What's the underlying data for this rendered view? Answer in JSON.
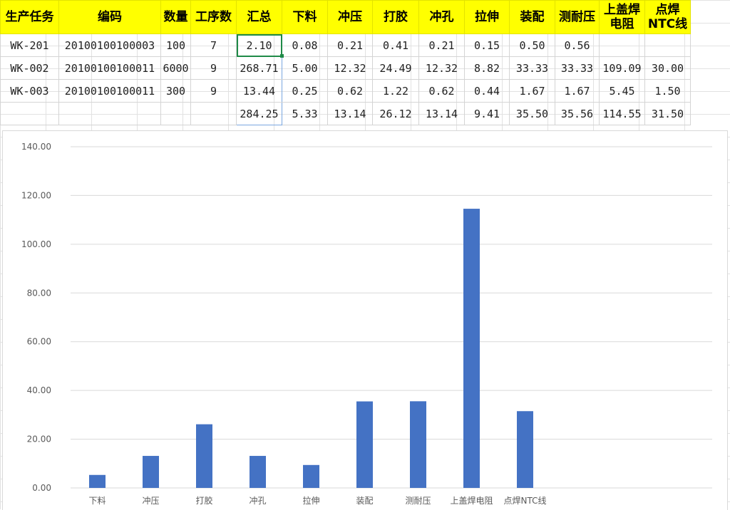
{
  "table": {
    "headers": [
      "生产任务",
      "编码",
      "数量",
      "工序数",
      "汇总",
      "下料",
      "冲压",
      "打胶",
      "冲孔",
      "拉伸",
      "装配",
      "测耐压",
      "上盖焊电阻",
      "点焊NTC线"
    ],
    "rows": [
      [
        "WK-201",
        "20100100100003",
        "100",
        "7",
        "2.10",
        "0.08",
        "0.21",
        "0.41",
        "0.21",
        "0.15",
        "0.50",
        "0.56",
        "",
        ""
      ],
      [
        "WK-002",
        "20100100100011",
        "6000",
        "9",
        "268.71",
        "5.00",
        "12.32",
        "24.49",
        "12.32",
        "8.82",
        "33.33",
        "33.33",
        "109.09",
        "30.00"
      ],
      [
        "WK-003",
        "20100100100011",
        "300",
        "9",
        "13.44",
        "0.25",
        "0.62",
        "1.22",
        "0.62",
        "0.44",
        "1.67",
        "1.67",
        "5.45",
        "1.50"
      ],
      [
        "",
        "",
        "",
        "",
        "284.25",
        "5.33",
        "13.14",
        "26.12",
        "13.14",
        "9.41",
        "35.50",
        "35.56",
        "114.55",
        "31.50"
      ]
    ]
  },
  "chart_data": {
    "type": "bar",
    "categories": [
      "下料",
      "冲压",
      "打胶",
      "冲孔",
      "拉伸",
      "装配",
      "测耐压",
      "上盖焊电阻",
      "点焊NTC线"
    ],
    "values": [
      5.33,
      13.14,
      26.12,
      13.14,
      9.41,
      35.5,
      35.56,
      114.55,
      31.5
    ],
    "ylim": [
      0,
      140
    ],
    "yticks": [
      "0.00",
      "20.00",
      "40.00",
      "60.00",
      "80.00",
      "100.00",
      "120.00",
      "140.00"
    ],
    "grid": true,
    "bar_color": "#4472c4",
    "title": "",
    "xlabel": "",
    "ylabel": ""
  }
}
